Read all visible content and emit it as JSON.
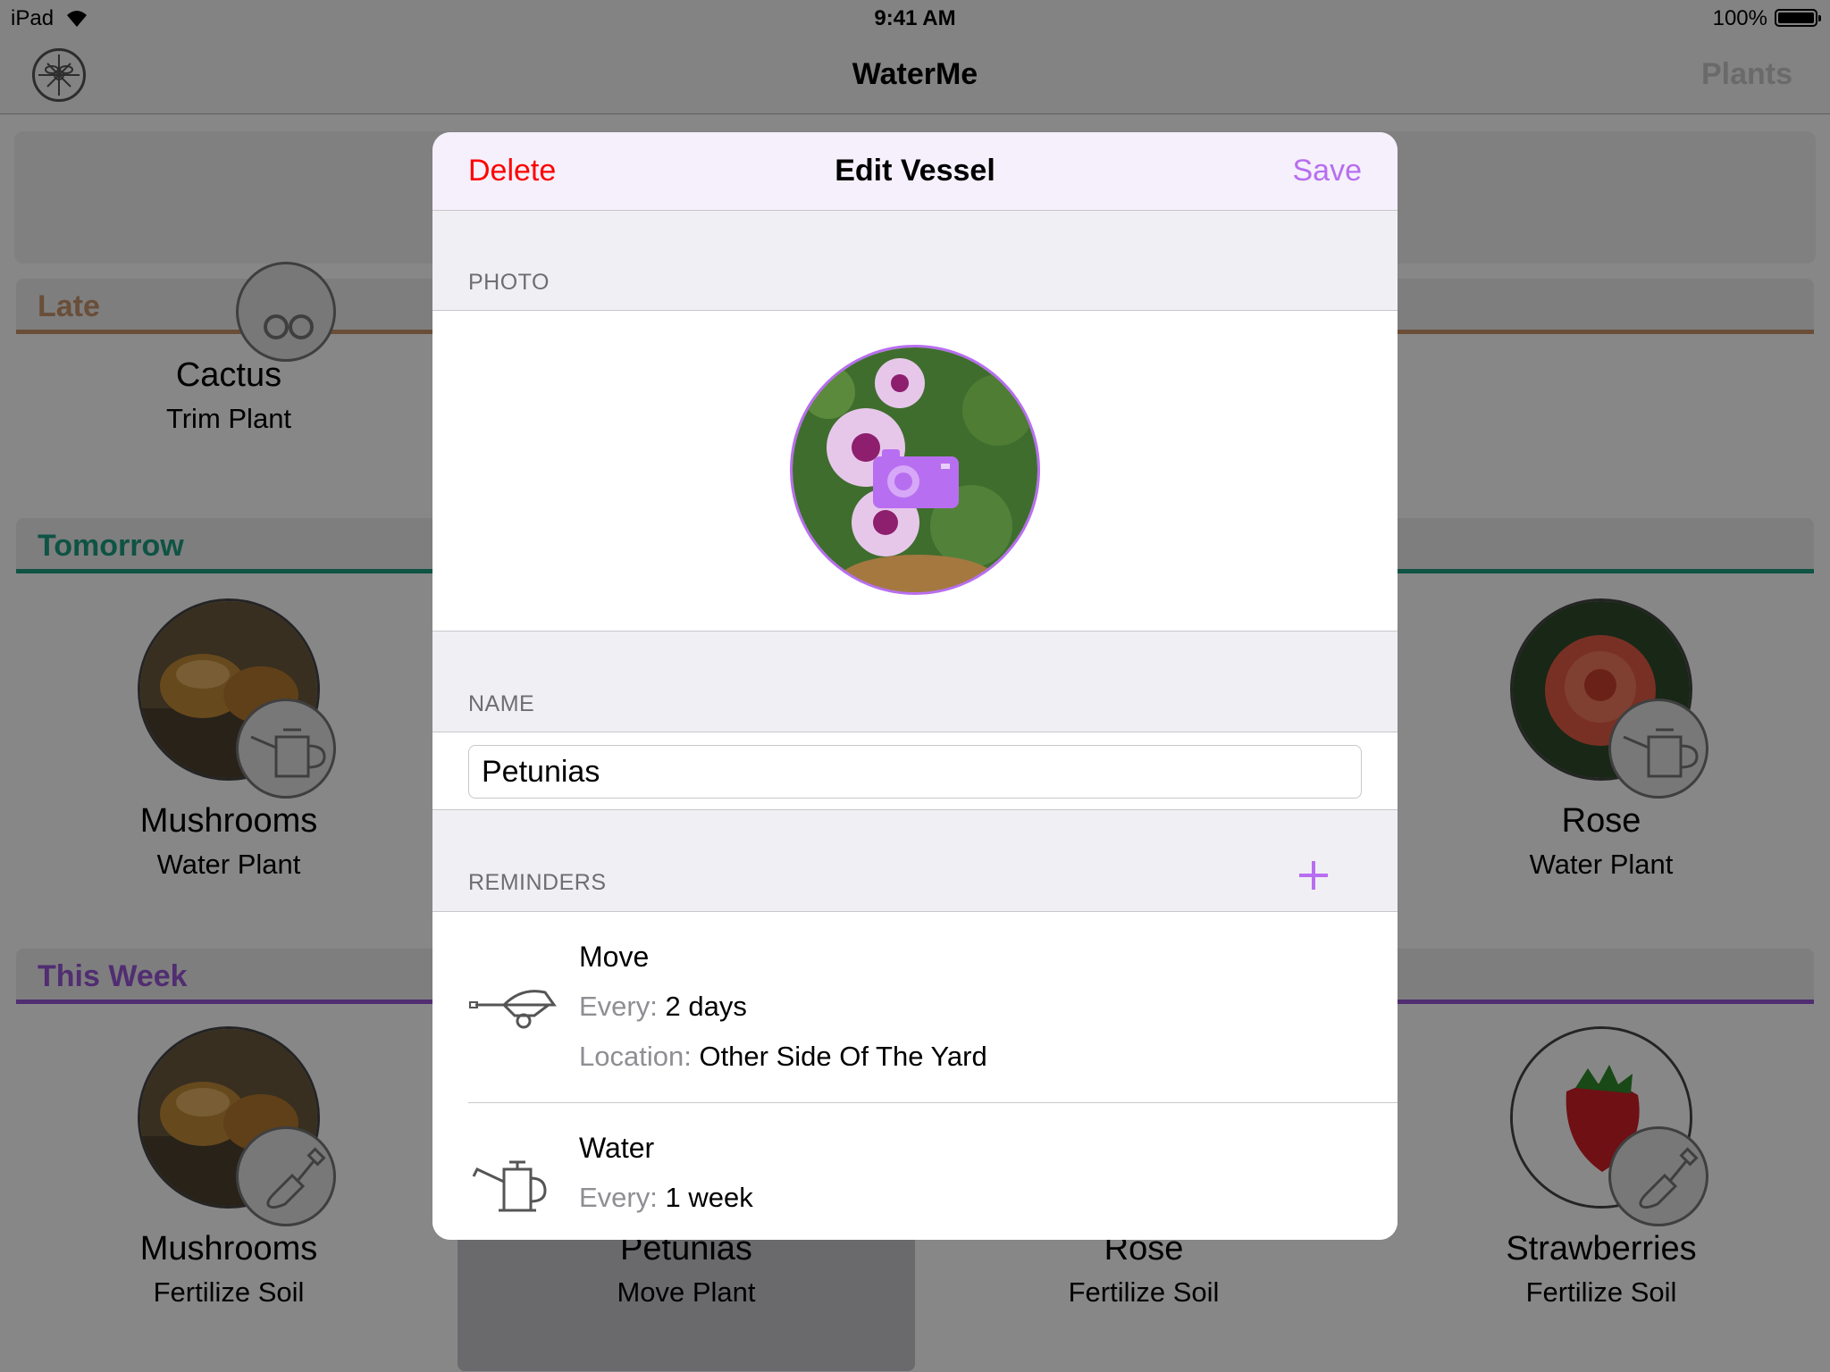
{
  "status_bar": {
    "carrier": "iPad",
    "time": "9:41 AM",
    "battery": "100%"
  },
  "nav": {
    "title": "WaterMe",
    "right_button": "Plants"
  },
  "sections": [
    {
      "title": "Late",
      "color": "#c9936a"
    },
    {
      "title": "Tomorrow",
      "color": "#1e9e80"
    },
    {
      "title": "This Week",
      "color": "#9a55d6"
    }
  ],
  "plants": {
    "late_1": {
      "name": "Cactus",
      "action": "Trim Plant"
    },
    "tomorrow_1": {
      "name": "Mushrooms",
      "action": "Water Plant"
    },
    "tomorrow_4": {
      "name": "Rose",
      "action": "Water Plant"
    },
    "week_1": {
      "name": "Mushrooms",
      "action": "Fertilize Soil"
    },
    "week_2": {
      "name": "Petunias",
      "action": "Move Plant"
    },
    "week_3": {
      "name": "Rose",
      "action": "Fertilize Soil"
    },
    "week_4": {
      "name": "Strawberries",
      "action": "Fertilize Soil"
    }
  },
  "modal": {
    "delete_label": "Delete",
    "title": "Edit Vessel",
    "save_label": "Save",
    "photo_header": "PHOTO",
    "name_header": "NAME",
    "name_value": "Petunias",
    "reminders_header": "REMINDERS",
    "reminders": [
      {
        "icon": "wheelbarrow-icon",
        "title": "Move",
        "every_label": "Every:",
        "every_value": "2 days",
        "location_label": "Location:",
        "location_value": "Other Side Of The Yard"
      },
      {
        "icon": "watering-can-icon",
        "title": "Water",
        "every_label": "Every:",
        "every_value": "1 week"
      }
    ]
  },
  "colors": {
    "accent": "#b86ef0",
    "destructive": "#ff0000"
  }
}
